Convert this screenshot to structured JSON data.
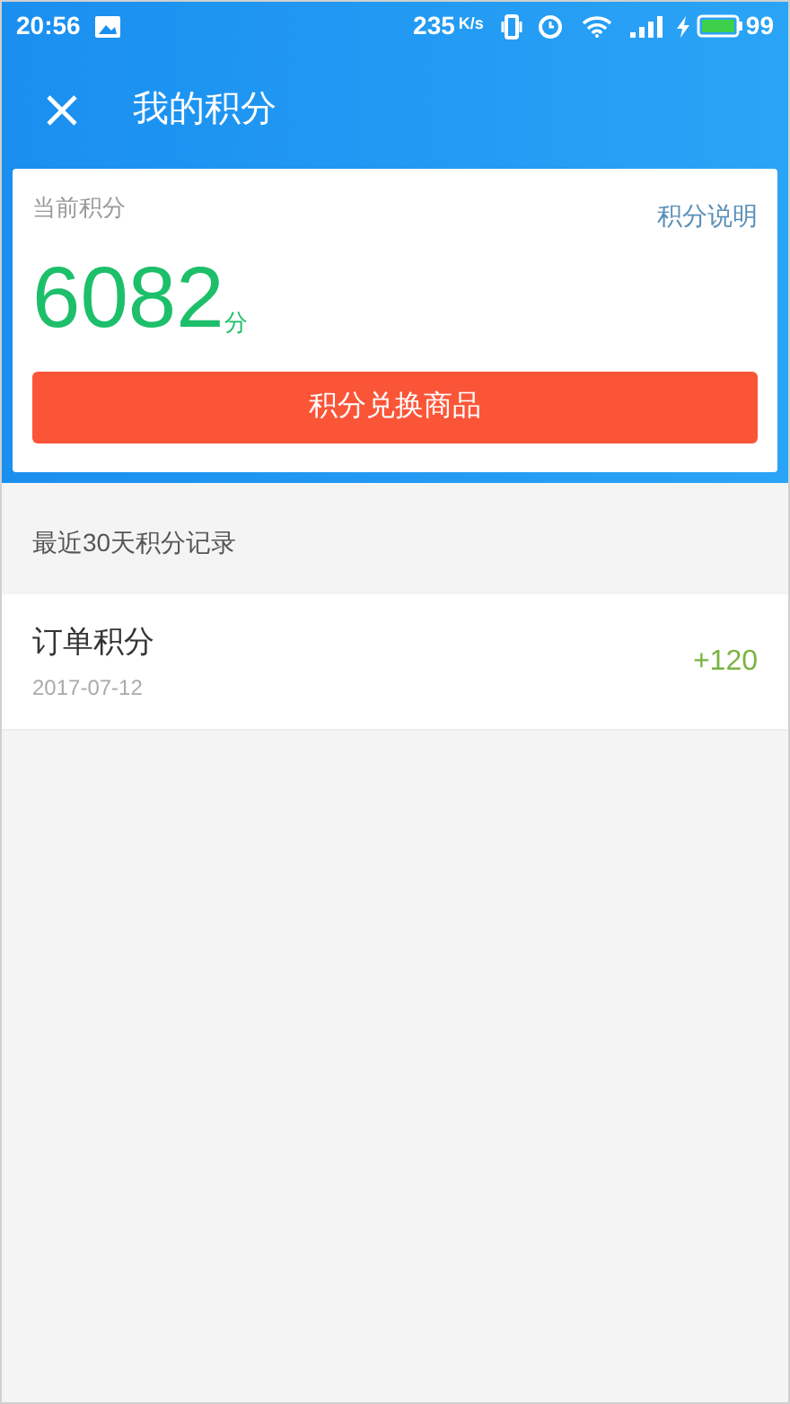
{
  "status_bar": {
    "time": "20:56",
    "speed": "235",
    "speed_unit": "K/s",
    "battery": "99"
  },
  "header": {
    "title": "我的积分"
  },
  "points_card": {
    "label": "当前积分",
    "help_link": "积分说明",
    "points": "6082",
    "unit": "分",
    "button": "积分兑换商品"
  },
  "records": {
    "title": "最近30天积分记录",
    "items": [
      {
        "name": "订单积分",
        "date": "2017-07-12",
        "amount": "+120"
      }
    ]
  }
}
